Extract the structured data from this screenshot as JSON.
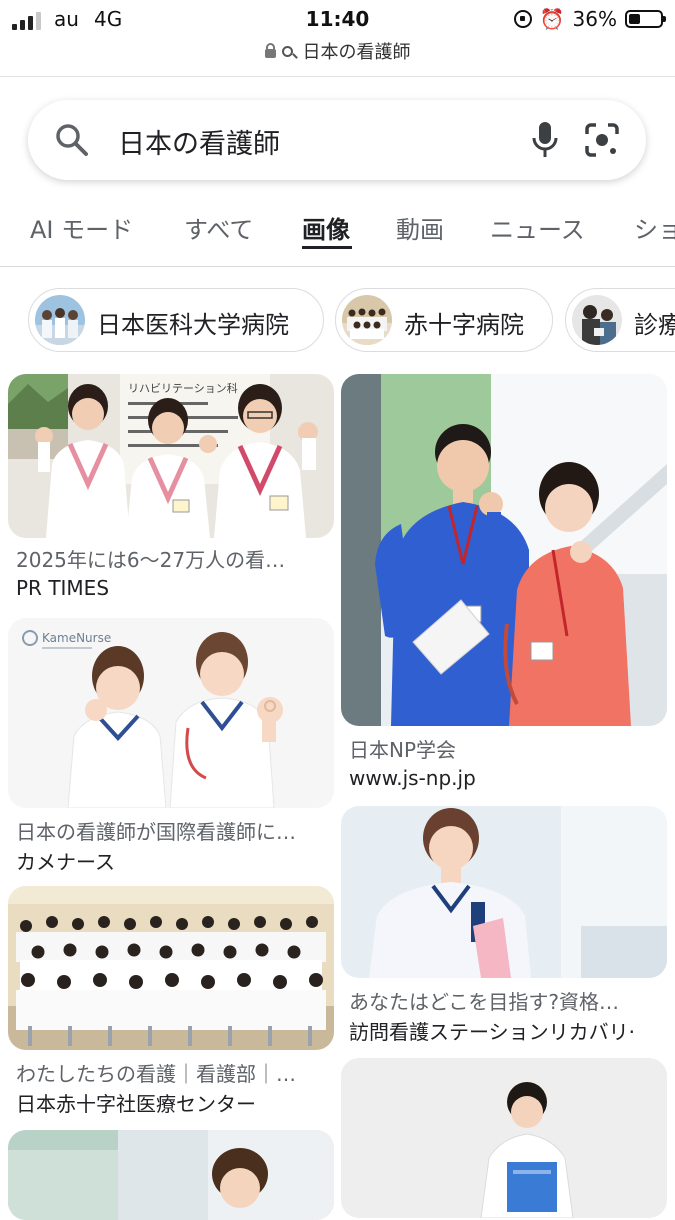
{
  "status_bar": {
    "carrier": "au",
    "network": "4G",
    "time": "11:40",
    "battery_percent": "36%",
    "battery_level": 0.36,
    "url": "日本の看護師"
  },
  "search": {
    "query": "日本の看護師"
  },
  "tabs": [
    {
      "label": "AI モード"
    },
    {
      "label": "すべて"
    },
    {
      "label": "画像",
      "active": true
    },
    {
      "label": "動画"
    },
    {
      "label": "ニュース"
    },
    {
      "label": "ショ"
    }
  ],
  "chips": [
    {
      "label": "日本医科大学病院"
    },
    {
      "label": "赤十字病院"
    },
    {
      "label": "診療"
    }
  ],
  "results": [
    {
      "caption": "2025年には6～27万人の看…",
      "source": "PR TIMES"
    },
    {
      "caption": "日本の看護師が国際看護師に…",
      "source": "カメナース",
      "watermark": "KameNurse"
    },
    {
      "caption": "わたしたちの看護｜看護部｜…",
      "source": "日本赤十字社医療センター"
    },
    {
      "caption": "日本NP学会",
      "source": "www.js-np.jp"
    },
    {
      "caption": "あなたはどこを目指す?資格…",
      "source": "訪問看護ステーションリカバリ·"
    }
  ],
  "image1_sign": "リハビリテーション科"
}
